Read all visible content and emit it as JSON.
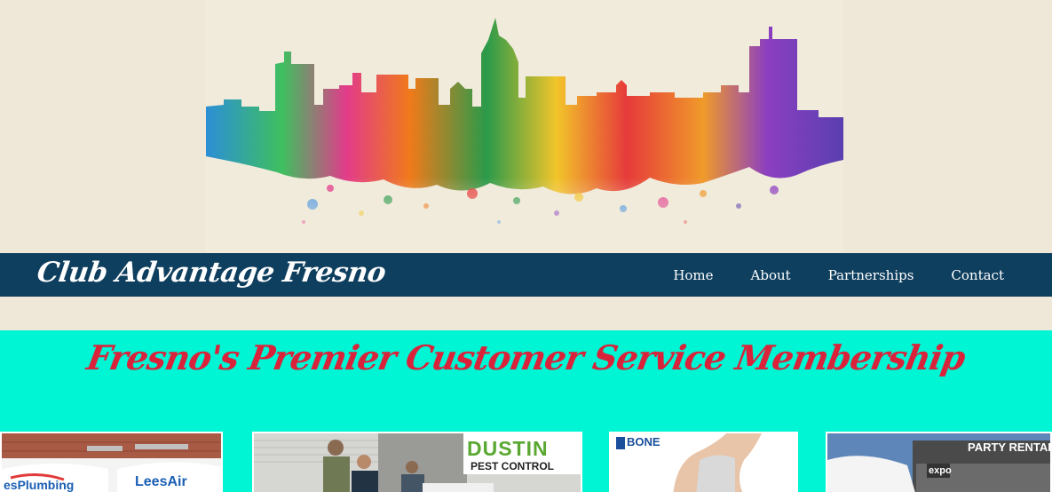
{
  "site": {
    "title": "Club Advantage Fresno"
  },
  "nav": {
    "items": [
      {
        "label": "Home"
      },
      {
        "label": "About"
      },
      {
        "label": "Partnerships"
      },
      {
        "label": "Contact"
      }
    ]
  },
  "hero": {
    "image": "watercolor-fresno-skyline"
  },
  "tagline": "Fresno's Premier Customer Service Membership",
  "partners": [
    {
      "image": "plumbing-and-air-vans",
      "visible_text_a": "esPlumbing",
      "visible_text_b": "LeesAir"
    },
    {
      "image": "pest-control-team",
      "brand_line1": "DUSTIN",
      "brand_line2": "PEST CONTROL"
    },
    {
      "image": "bone-store-brace",
      "brand": "BONE"
    },
    {
      "image": "party-rentals-storefront",
      "sign": "PARTY RENTALS",
      "sign_small": "expo"
    }
  ],
  "colors": {
    "background": "#efe8d8",
    "navbar": "#0f3f5f",
    "nav_text": "#ffffff",
    "tagline_band": "#00f5d4",
    "tagline_text": "#d9233b"
  }
}
